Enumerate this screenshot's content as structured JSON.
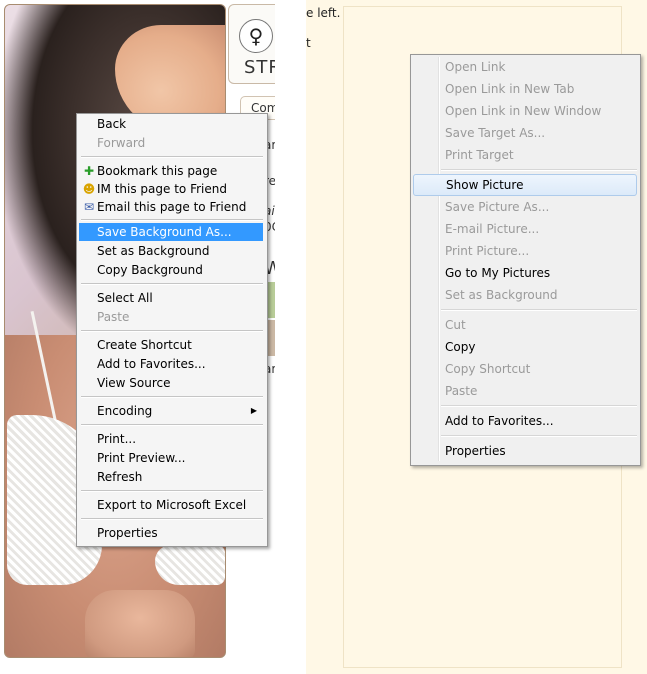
{
  "left_page": {
    "logo_text": "STR",
    "tab_label": "Com",
    "fragments": [
      "ar",
      "re",
      "ai",
      "0C",
      "W",
      "ar"
    ]
  },
  "left_menu": {
    "items": [
      {
        "label": "Back",
        "disabled": false
      },
      {
        "label": "Forward",
        "disabled": true
      },
      {
        "label": "Bookmark this page",
        "icon": "bookmark-add-icon"
      },
      {
        "label": "IM this page to Friend",
        "icon": "smiley-icon"
      },
      {
        "label": "Email this page to Friend",
        "icon": "envelope-icon"
      },
      {
        "label": "Save Background As...",
        "highlighted": true
      },
      {
        "label": "Set as Background"
      },
      {
        "label": "Copy Background"
      },
      {
        "label": "Select All"
      },
      {
        "label": "Paste",
        "disabled": true
      },
      {
        "label": "Create Shortcut"
      },
      {
        "label": "Add to Favorites..."
      },
      {
        "label": "View Source"
      },
      {
        "label": "Encoding",
        "submenu": true
      },
      {
        "label": "Print..."
      },
      {
        "label": "Print Preview..."
      },
      {
        "label": "Refresh"
      },
      {
        "label": "Export to Microsoft Excel"
      },
      {
        "label": "Properties"
      }
    ],
    "highlight_color": "#3399ff"
  },
  "right_page": {
    "fragment_1": "e left.",
    "fragment_2": "t"
  },
  "right_menu": {
    "items": [
      {
        "label": "Open Link",
        "disabled": true
      },
      {
        "label": "Open Link in New Tab",
        "disabled": true
      },
      {
        "label": "Open Link in New Window",
        "disabled": true
      },
      {
        "label": "Save Target As...",
        "disabled": true
      },
      {
        "label": "Print Target",
        "disabled": true
      },
      {
        "label": "Show Picture",
        "highlighted": true
      },
      {
        "label": "Save Picture As...",
        "disabled": true
      },
      {
        "label": "E-mail Picture...",
        "disabled": true
      },
      {
        "label": "Print Picture...",
        "disabled": true
      },
      {
        "label": "Go to My Pictures"
      },
      {
        "label": "Set as Background",
        "disabled": true
      },
      {
        "label": "Cut",
        "disabled": true
      },
      {
        "label": "Copy"
      },
      {
        "label": "Copy Shortcut",
        "disabled": true
      },
      {
        "label": "Paste",
        "disabled": true
      },
      {
        "label": "Add to Favorites..."
      },
      {
        "label": "Properties"
      }
    ]
  }
}
